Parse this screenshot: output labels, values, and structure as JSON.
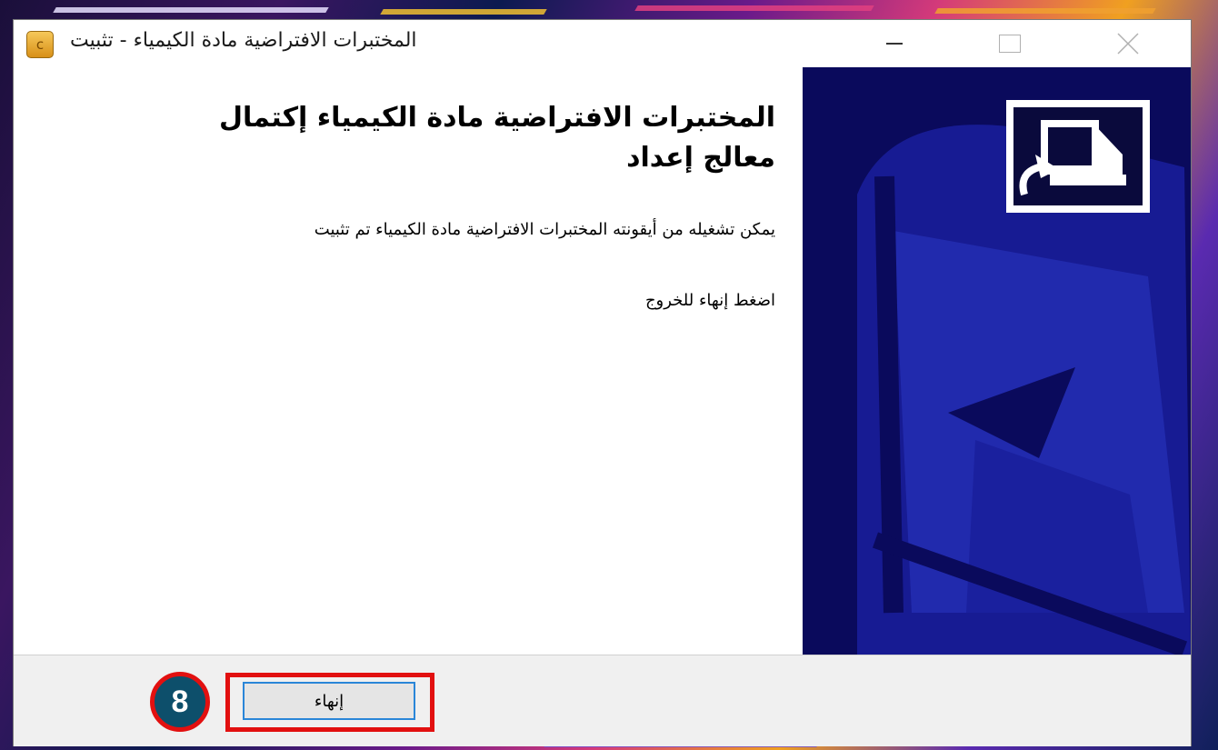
{
  "window": {
    "title": "المختبرات الافتراضية مادة الكيمياء - تثبيت",
    "app_icon_letter": "c"
  },
  "content": {
    "heading": "المختبرات الافتراضية مادة الكيمياء إكتمال معالج إعداد",
    "body": "يمكن تشغيله من أيقونته المختبرات الافتراضية مادة الكيمياء تم تثبيت",
    "exit_hint": "اضغط إنهاء للخروج"
  },
  "footer": {
    "finish_label": "إنهاء"
  },
  "annotation": {
    "step_number": "8",
    "highlight_color": "#e21010",
    "badge_color": "#0d4f6b"
  },
  "icons": {
    "setup_icon": "computer-install-icon",
    "minimize": "minimize-icon",
    "maximize": "maximize-icon",
    "close": "close-icon"
  }
}
